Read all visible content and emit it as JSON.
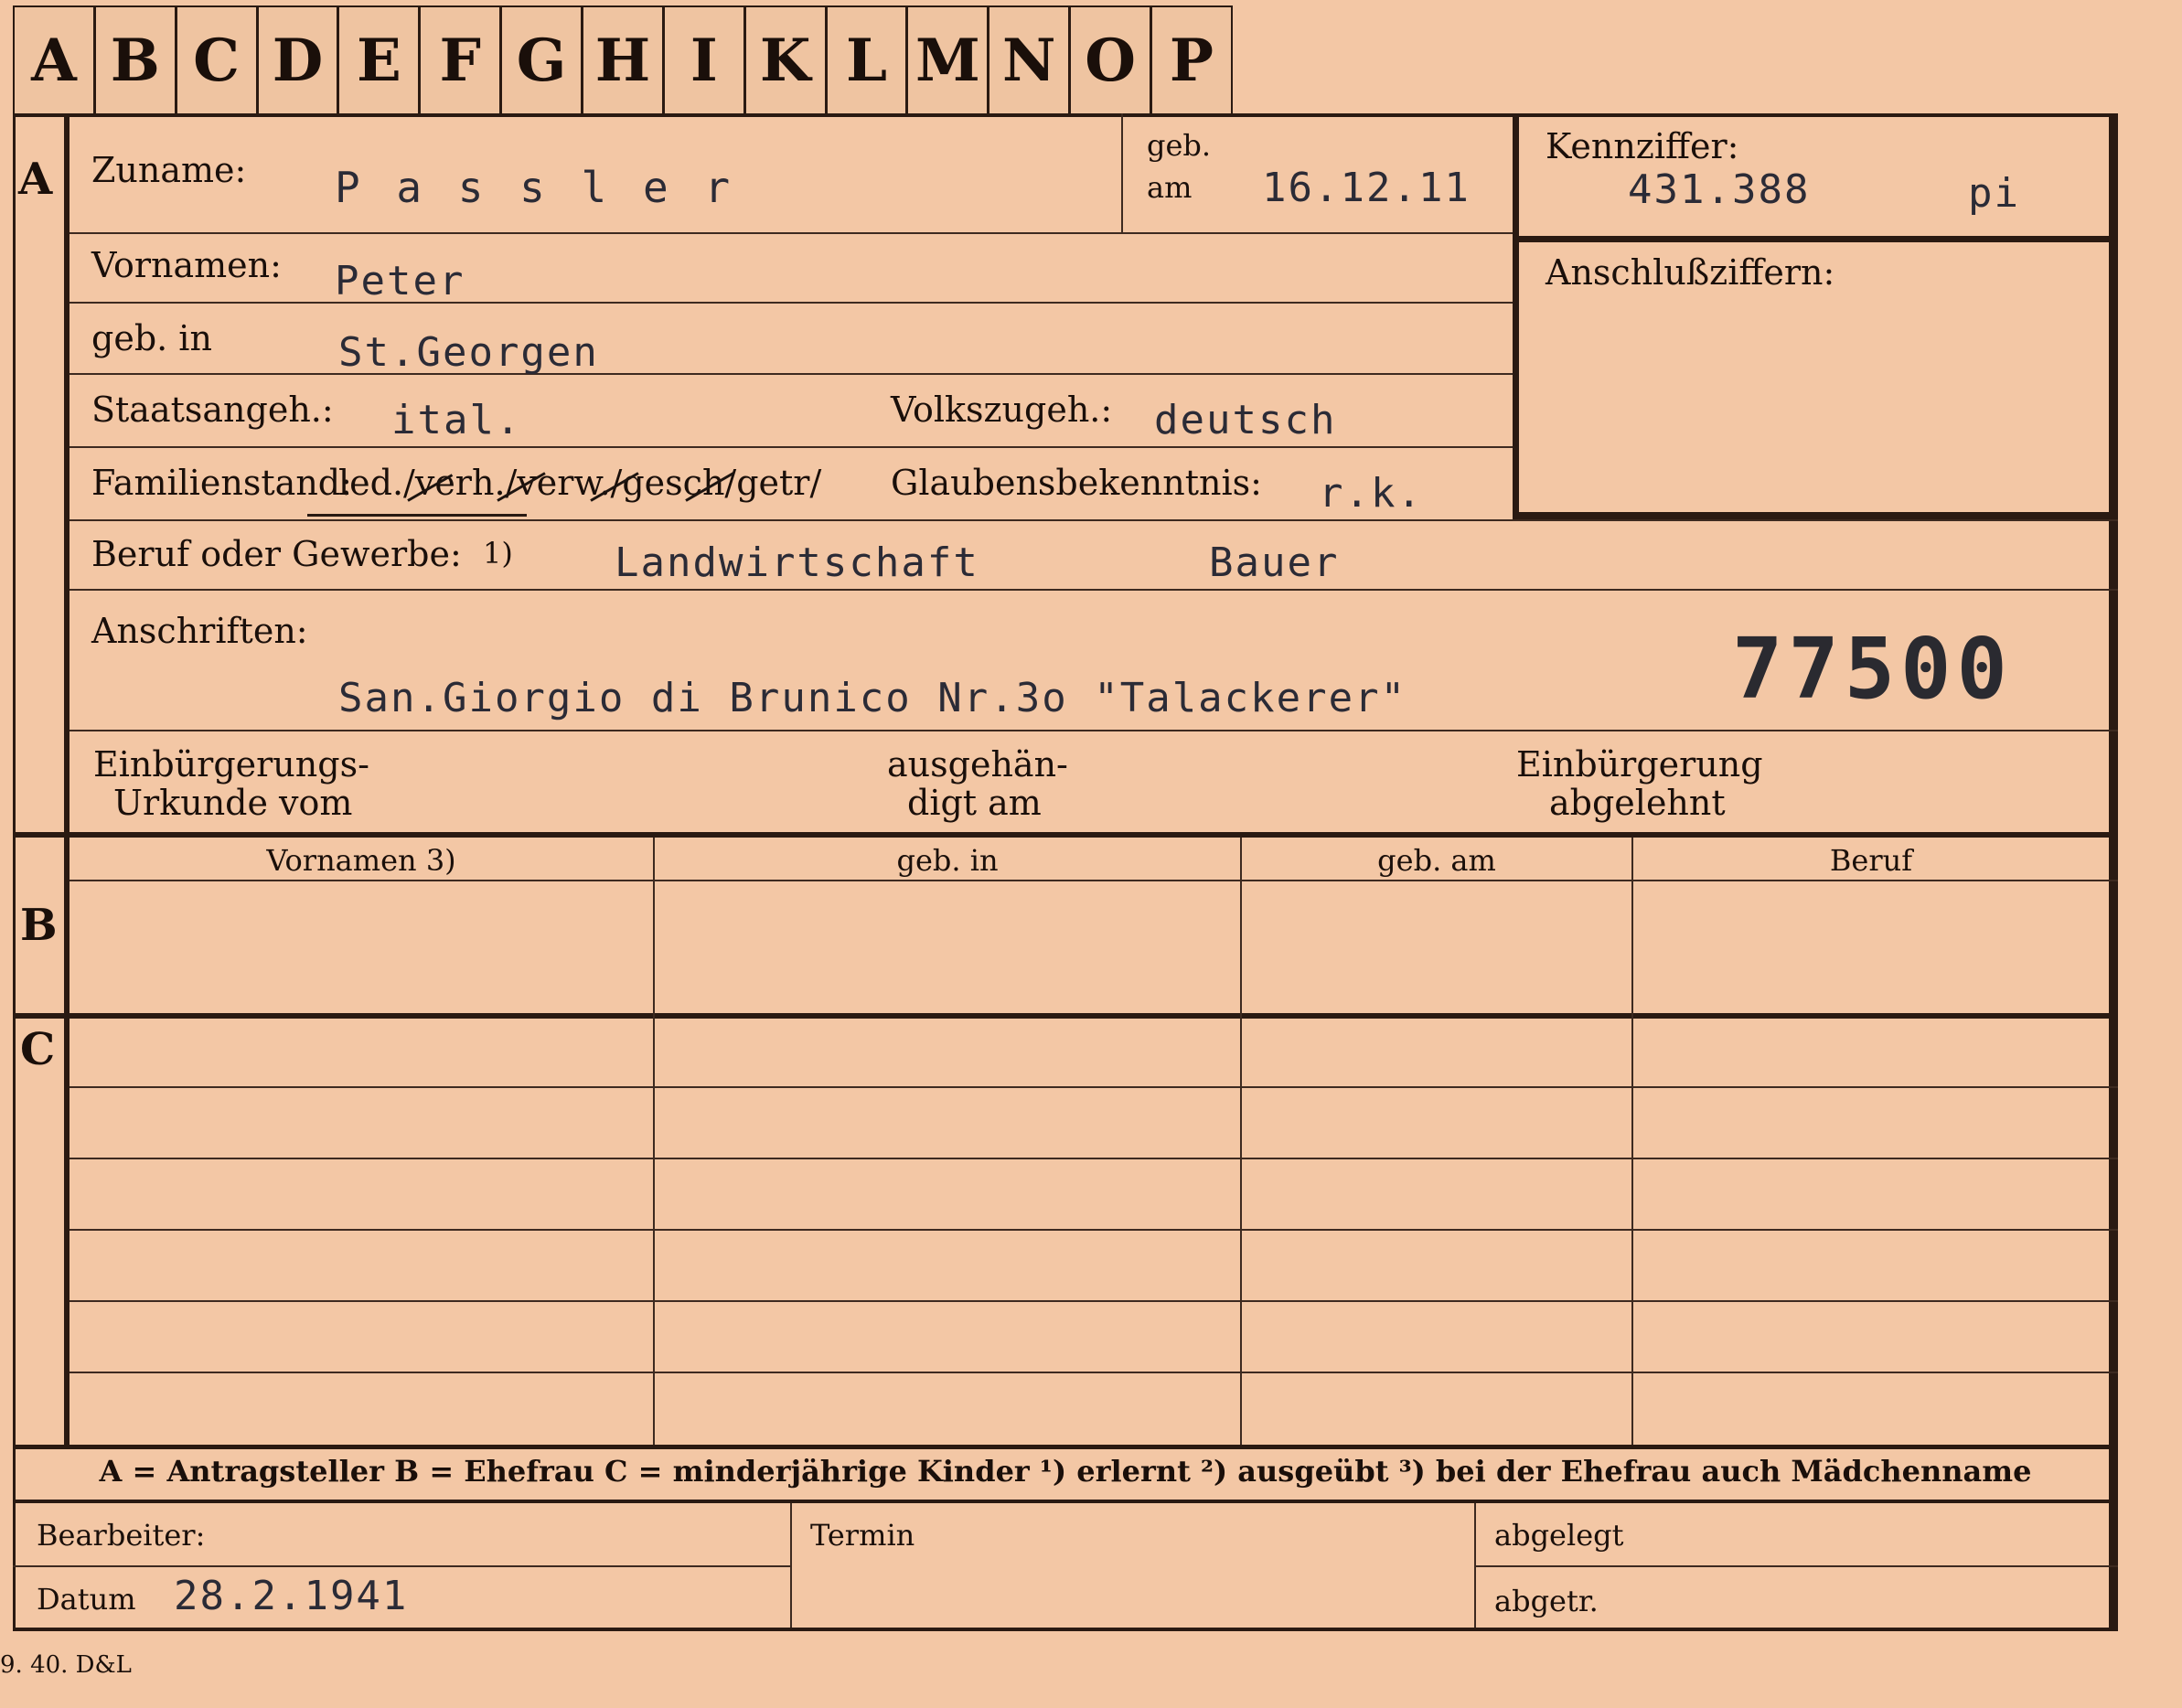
{
  "tabs": [
    "A",
    "B",
    "C",
    "D",
    "E",
    "F",
    "G",
    "H",
    "I",
    "K",
    "L",
    "M",
    "N",
    "O",
    "P"
  ],
  "sections": {
    "a": "A",
    "b": "B",
    "c": "C"
  },
  "applicant": {
    "zuname_label": "Zuname:",
    "zuname": "P a s s l e r",
    "geb_am_label_1": "geb.",
    "geb_am_label_2": "am",
    "geb_am": "16.12.11",
    "vornamen_label": "Vornamen:",
    "vornamen": "Peter",
    "geb_in_label": "geb. in",
    "geb_in": "St.Georgen",
    "staatsangeh_label": "Staatsangeh.:",
    "staatsangeh": "ital.",
    "volkszugeh_label": "Volkszugeh.:",
    "volkszugeh": "deutsch",
    "familienstand_label": "Familienstand:",
    "familienstand_options": "led./verh./verw./gesch/getr/",
    "glaubensbekenntnis_label": "Glaubensbekenntnis:",
    "glaubensbekenntnis": "r.k.",
    "beruf_label": "Beruf oder Gewerbe:",
    "beruf_note": "1)",
    "beruf_1": "Landwirtschaft",
    "beruf_2": "Bauer",
    "anschriften_label": "Anschriften:",
    "anschrift": "San.Giorgio di Brunico Nr.3o \"Talackerer\"",
    "stamp_number": "77500",
    "einbuergerung_label_1": "Einbürgerungs-",
    "einbuergerung_label_2": "Urkunde vom",
    "ausgehaendigt_label_1": "ausgehän-",
    "ausgehaendigt_label_2": "digt am",
    "abgelehnt_label_1": "Einbürgerung",
    "abgelehnt_label_2": "abgelehnt"
  },
  "kennziffer": {
    "label": "Kennziffer:",
    "value": "431.388",
    "suffix": "pi",
    "anschluss_label": "Anschlußziffern:"
  },
  "table": {
    "headers": [
      "Vornamen 3)",
      "geb. in",
      "geb. am",
      "Beruf"
    ]
  },
  "legend": "A = Antragsteller   B = Ehefrau   C = minderjährige Kinder   ¹) erlernt   ²) ausgeübt   ³) bei der Ehefrau auch Mädchenname",
  "bottom": {
    "bearbeiter_label": "Bearbeiter:",
    "datum_label": "Datum",
    "datum": "28.2.1941",
    "termin_label": "Termin",
    "abgelegt_label": "abgelegt",
    "abgetr_label": "abgetr."
  },
  "footer_code": "9. 40. D&L"
}
